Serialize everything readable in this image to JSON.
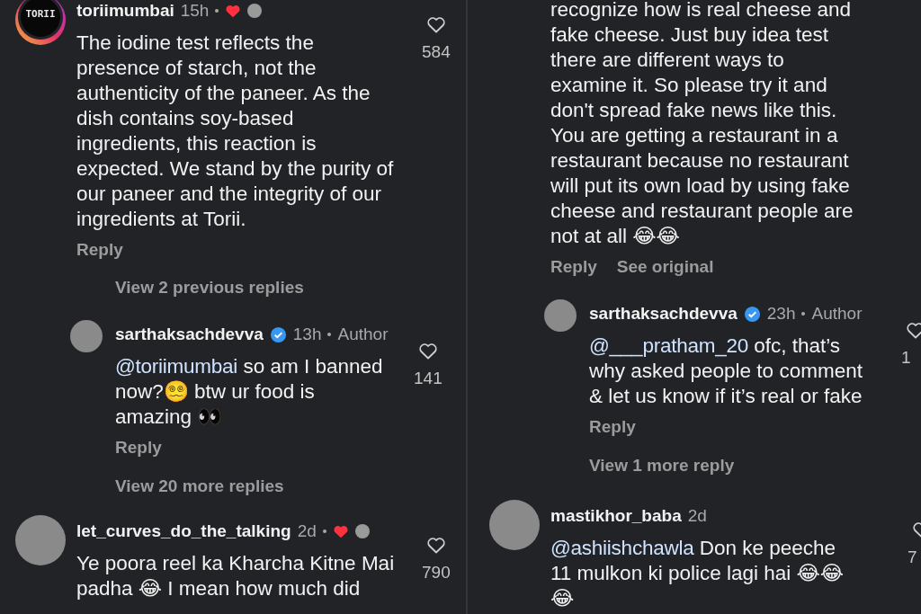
{
  "panels": [
    {
      "comments": [
        {
          "avatar": {
            "kind": "logo",
            "text": "TORII",
            "story_ring": true
          },
          "username": "toriimumbai",
          "time": "15h",
          "liked_by_creator": true,
          "body": [
            {
              "kind": "text",
              "text": "The iodine test reflects the presence of starch, not the authenticity of the paneer. As the dish contains soy-based ingredients, this reaction is expected. We stand by the purity of our paneer and the integrity of our ingredients at Torii."
            }
          ],
          "likes": "584",
          "actions": [
            "Reply"
          ],
          "replies": [
            {
              "kind": "more",
              "text": "View 2 previous replies"
            },
            {
              "kind": "comment",
              "avatar": {
                "kind": "photo",
                "story_ring": false
              },
              "username": "sarthaksachdevva",
              "verified": true,
              "time": "13h",
              "role": "Author",
              "body": [
                {
                  "kind": "mention",
                  "text": "@toriimumbai"
                },
                {
                  "kind": "text",
                  "text": " so am I banned now?😵‍💫 btw ur food is amazing "
                },
                {
                  "kind": "emoji",
                  "text": "👀"
                }
              ],
              "likes": "141",
              "actions": [
                "Reply"
              ]
            },
            {
              "kind": "more",
              "text": "View 20 more replies"
            }
          ]
        },
        {
          "avatar": {
            "kind": "photo",
            "story_ring": false
          },
          "username": "let_curves_do_the_talking",
          "time": "2d",
          "liked_by_creator": true,
          "body": [
            {
              "kind": "text",
              "text": "Ye poora reel ka Kharcha Kitne Mai padha 😂 I mean how much did"
            }
          ],
          "likes": "790"
        }
      ]
    },
    {
      "comments": [
        {
          "body": [
            {
              "kind": "text",
              "text": "recognize how is real cheese and fake cheese. Just buy idea test there are different ways to examine it. So please try it and don't spread fake news like this. You are getting a restaurant in a restaurant because no restaurant will put its own load by using fake cheese and restaurant people are not at all 😂😂"
            }
          ],
          "actions": [
            "Reply",
            "See original"
          ],
          "replies": [
            {
              "kind": "comment",
              "avatar": {
                "kind": "photo",
                "story_ring": false
              },
              "username": "sarthaksachdevva",
              "verified": true,
              "time": "23h",
              "role": "Author",
              "body": [
                {
                  "kind": "mention",
                  "text": "@___pratham_20"
                },
                {
                  "kind": "text",
                  "text": " ofc, that’s why asked people to comment & let us know if it’s real or fake"
                }
              ],
              "likes": "1",
              "actions": [
                "Reply"
              ]
            },
            {
              "kind": "more",
              "text": "View 1 more reply"
            }
          ]
        },
        {
          "avatar": {
            "kind": "photo",
            "story_ring": false
          },
          "username": "mastikhor_baba",
          "time": "2d",
          "body": [
            {
              "kind": "mention",
              "text": "@ashiishchawla"
            },
            {
              "kind": "text",
              "text": " Don ke peeche 11 mulkon ki police lagi hai 😂😂😂"
            }
          ],
          "likes": "7"
        }
      ]
    }
  ]
}
